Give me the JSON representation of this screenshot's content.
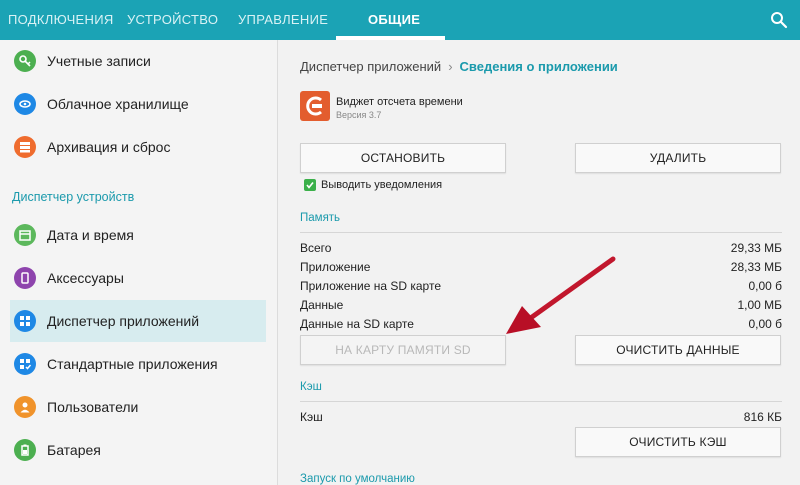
{
  "tabs": [
    {
      "label": "ПОДКЛЮЧЕНИЯ",
      "active": false
    },
    {
      "label": "УСТРОЙСТВО",
      "active": false
    },
    {
      "label": "УПРАВЛЕНИЕ",
      "active": false
    },
    {
      "label": "ОБЩИЕ",
      "active": true
    }
  ],
  "sidebar": {
    "items_top": [
      {
        "label": "Учетные записи",
        "icon": "key-icon",
        "color": "#4caf50"
      },
      {
        "label": "Облачное хранилище",
        "icon": "cloud-icon",
        "color": "#1e88e5"
      },
      {
        "label": "Архивация и сброс",
        "icon": "archive-icon",
        "color": "#ef6c2e"
      }
    ],
    "section_header": "Диспетчер устройств",
    "items_device": [
      {
        "label": "Дата и время",
        "icon": "calendar-icon",
        "color": "#5cb85c"
      },
      {
        "label": "Аксессуары",
        "icon": "accessory-icon",
        "color": "#8e44ad"
      },
      {
        "label": "Диспетчер приложений",
        "icon": "grid-icon",
        "color": "#1e88e5",
        "selected": true
      },
      {
        "label": "Стандартные приложения",
        "icon": "apps-check-icon",
        "color": "#1e88e5"
      },
      {
        "label": "Пользователи",
        "icon": "users-icon",
        "color": "#f0932b"
      },
      {
        "label": "Батарея",
        "icon": "battery-icon",
        "color": "#4caf50"
      }
    ]
  },
  "breadcrumb": {
    "parent": "Диспетчер приложений",
    "current": "Сведения о приложении"
  },
  "app": {
    "name": "Виджет отсчета времени",
    "version": "Версия 3.7",
    "icon_color": "#e35d2e"
  },
  "buttons": {
    "stop": "ОСТАНОВИТЬ",
    "delete": "УДАЛИТЬ",
    "move_to_sd": "НА КАРТУ ПАМЯТИ SD",
    "clear_data": "ОЧИСТИТЬ ДАННЫЕ",
    "clear_cache": "ОЧИСТИТЬ КЭШ"
  },
  "notifications": {
    "label": "Выводить уведомления",
    "checked": true
  },
  "memory": {
    "title": "Память",
    "rows": [
      {
        "label": "Всего",
        "value": "29,33 МБ"
      },
      {
        "label": "Приложение",
        "value": "28,33 МБ"
      },
      {
        "label": "Приложение на SD карте",
        "value": "0,00 б"
      },
      {
        "label": "Данные",
        "value": "1,00 МБ"
      },
      {
        "label": "Данные на SD карте",
        "value": "0,00 б"
      }
    ]
  },
  "cache": {
    "title": "Кэш",
    "label": "Кэш",
    "value": "816 КБ"
  },
  "defaults": {
    "title": "Запуск по умолчанию"
  },
  "colors": {
    "accent": "#1ba3b5",
    "annotation_arrow": "#c8102e"
  }
}
